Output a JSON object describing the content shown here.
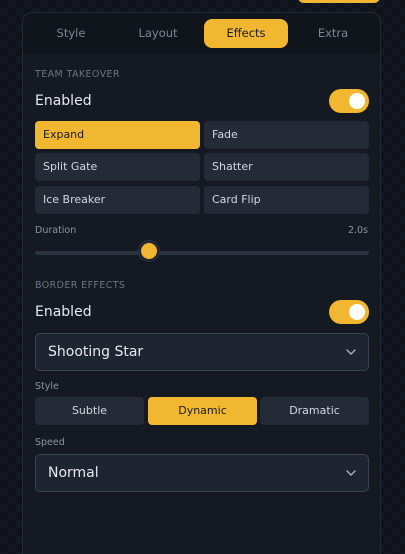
{
  "tabs": [
    {
      "label": "Style"
    },
    {
      "label": "Layout"
    },
    {
      "label": "Effects"
    },
    {
      "label": "Extra"
    }
  ],
  "team_takeover": {
    "section": "TEAM TAKEOVER",
    "enabled_label": "Enabled",
    "enabled": true,
    "animations": [
      {
        "label": "Expand",
        "selected": true
      },
      {
        "label": "Fade",
        "selected": false
      },
      {
        "label": "Split Gate",
        "selected": false
      },
      {
        "label": "Shatter",
        "selected": false
      },
      {
        "label": "Ice Breaker",
        "selected": false
      },
      {
        "label": "Card Flip",
        "selected": false
      }
    ],
    "duration_label": "Duration",
    "duration_value": "2.0s",
    "duration_fraction": 0.34
  },
  "border_effects": {
    "section": "BORDER EFFECTS",
    "enabled_label": "Enabled",
    "enabled": true,
    "effect_value": "Shooting Star",
    "style_label": "Style",
    "style_options": [
      {
        "label": "Subtle",
        "selected": false
      },
      {
        "label": "Dynamic",
        "selected": true
      },
      {
        "label": "Dramatic",
        "selected": false
      }
    ],
    "speed_label": "Speed",
    "speed_value": "Normal"
  },
  "colors": {
    "accent": "#f2b731",
    "panel": "#151922",
    "control": "#242b37"
  },
  "icons": {
    "dropdown": "chevron-down-icon"
  }
}
